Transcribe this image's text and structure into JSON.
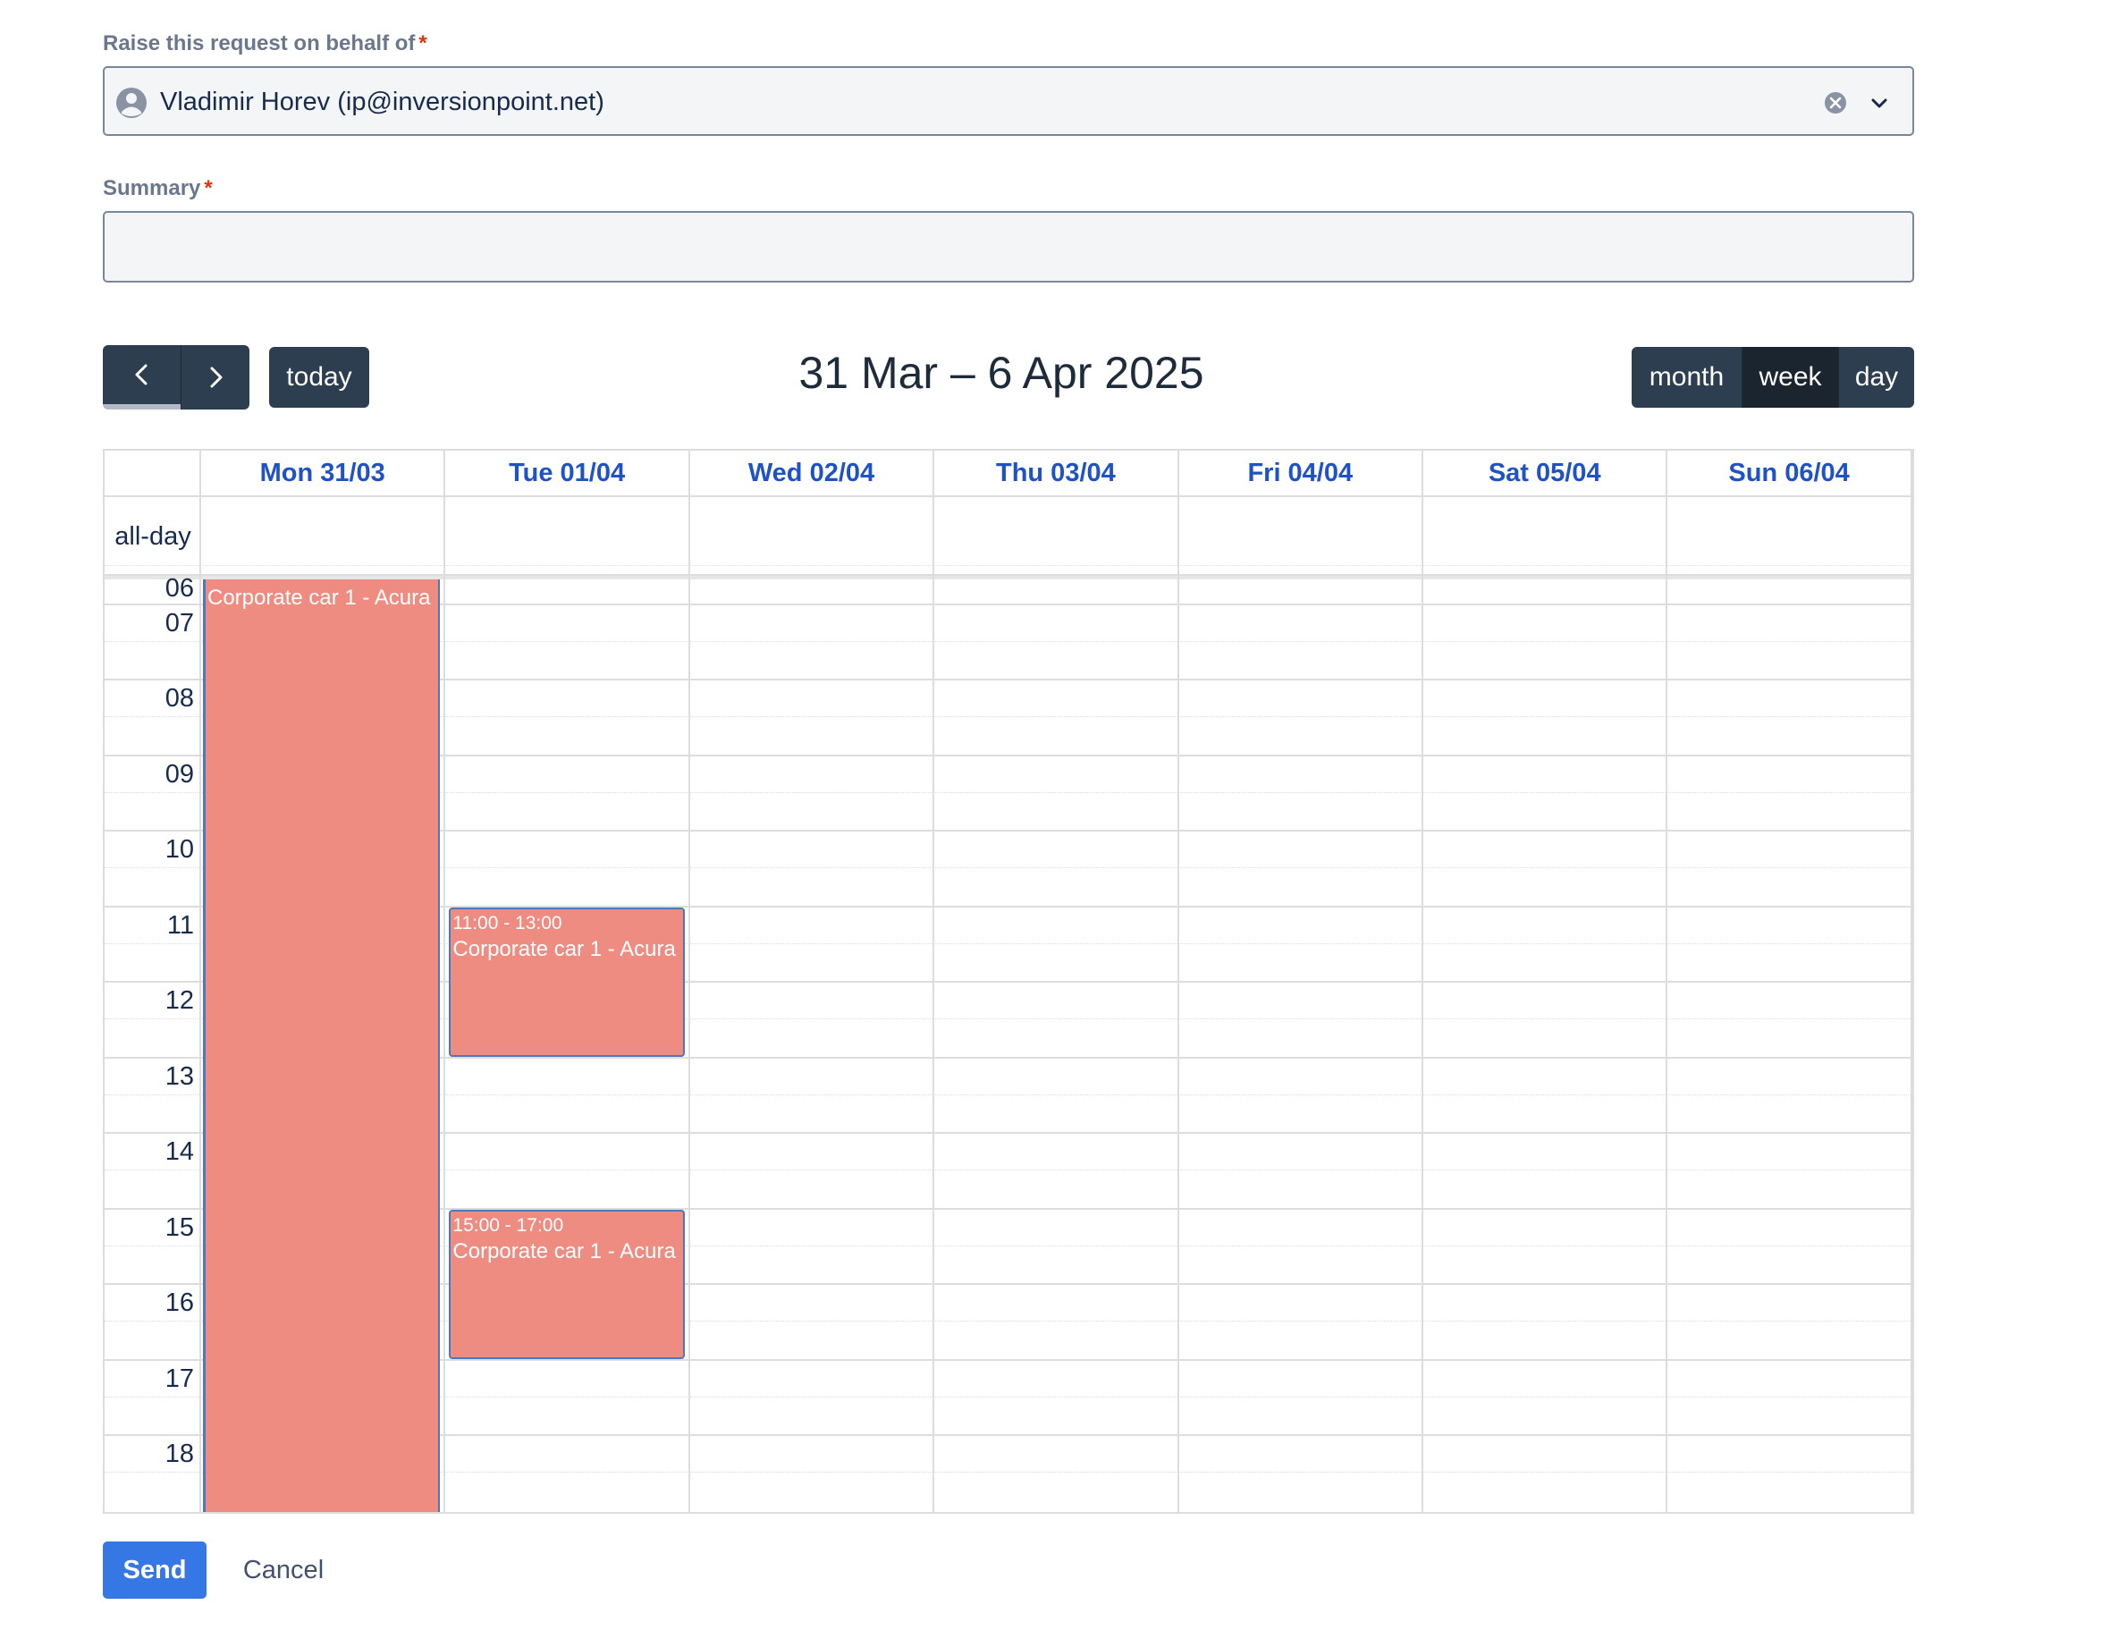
{
  "form": {
    "behalf_label": "Raise this request on behalf of",
    "required_mark": "*",
    "behalf_value": "Vladimir Horev (ip@inversionpoint.net)",
    "summary_label": "Summary",
    "summary_value": ""
  },
  "toolbar": {
    "prev_icon": "chevron-left-icon",
    "next_icon": "chevron-right-icon",
    "today_label": "today",
    "title": "31 Mar – 6 Apr 2025",
    "views": [
      "month",
      "week",
      "day"
    ],
    "active_view": "week"
  },
  "calendar": {
    "allday_label": "all-day",
    "days": [
      "Mon 31/03",
      "Tue 01/04",
      "Wed 02/04",
      "Thu 03/04",
      "Fri 04/04",
      "Sat 05/04",
      "Sun 06/04"
    ],
    "hours": [
      "06",
      "07",
      "08",
      "09",
      "10",
      "11",
      "12",
      "13",
      "14",
      "15",
      "16",
      "17",
      "18"
    ],
    "events": [
      {
        "day": "Mon 31/03",
        "time": "",
        "title": "Corporate car 1 - Acura"
      },
      {
        "day": "Tue 01/04",
        "time": "11:00 - 13:00",
        "title": "Corporate car 1 - Acura"
      },
      {
        "day": "Tue 01/04",
        "time": "15:00 - 17:00",
        "title": "Corporate car 1 - Acura"
      }
    ],
    "event_color": "#ee8c82",
    "header_color": "#1f52c7"
  },
  "actions": {
    "send_label": "Send",
    "cancel_label": "Cancel"
  }
}
